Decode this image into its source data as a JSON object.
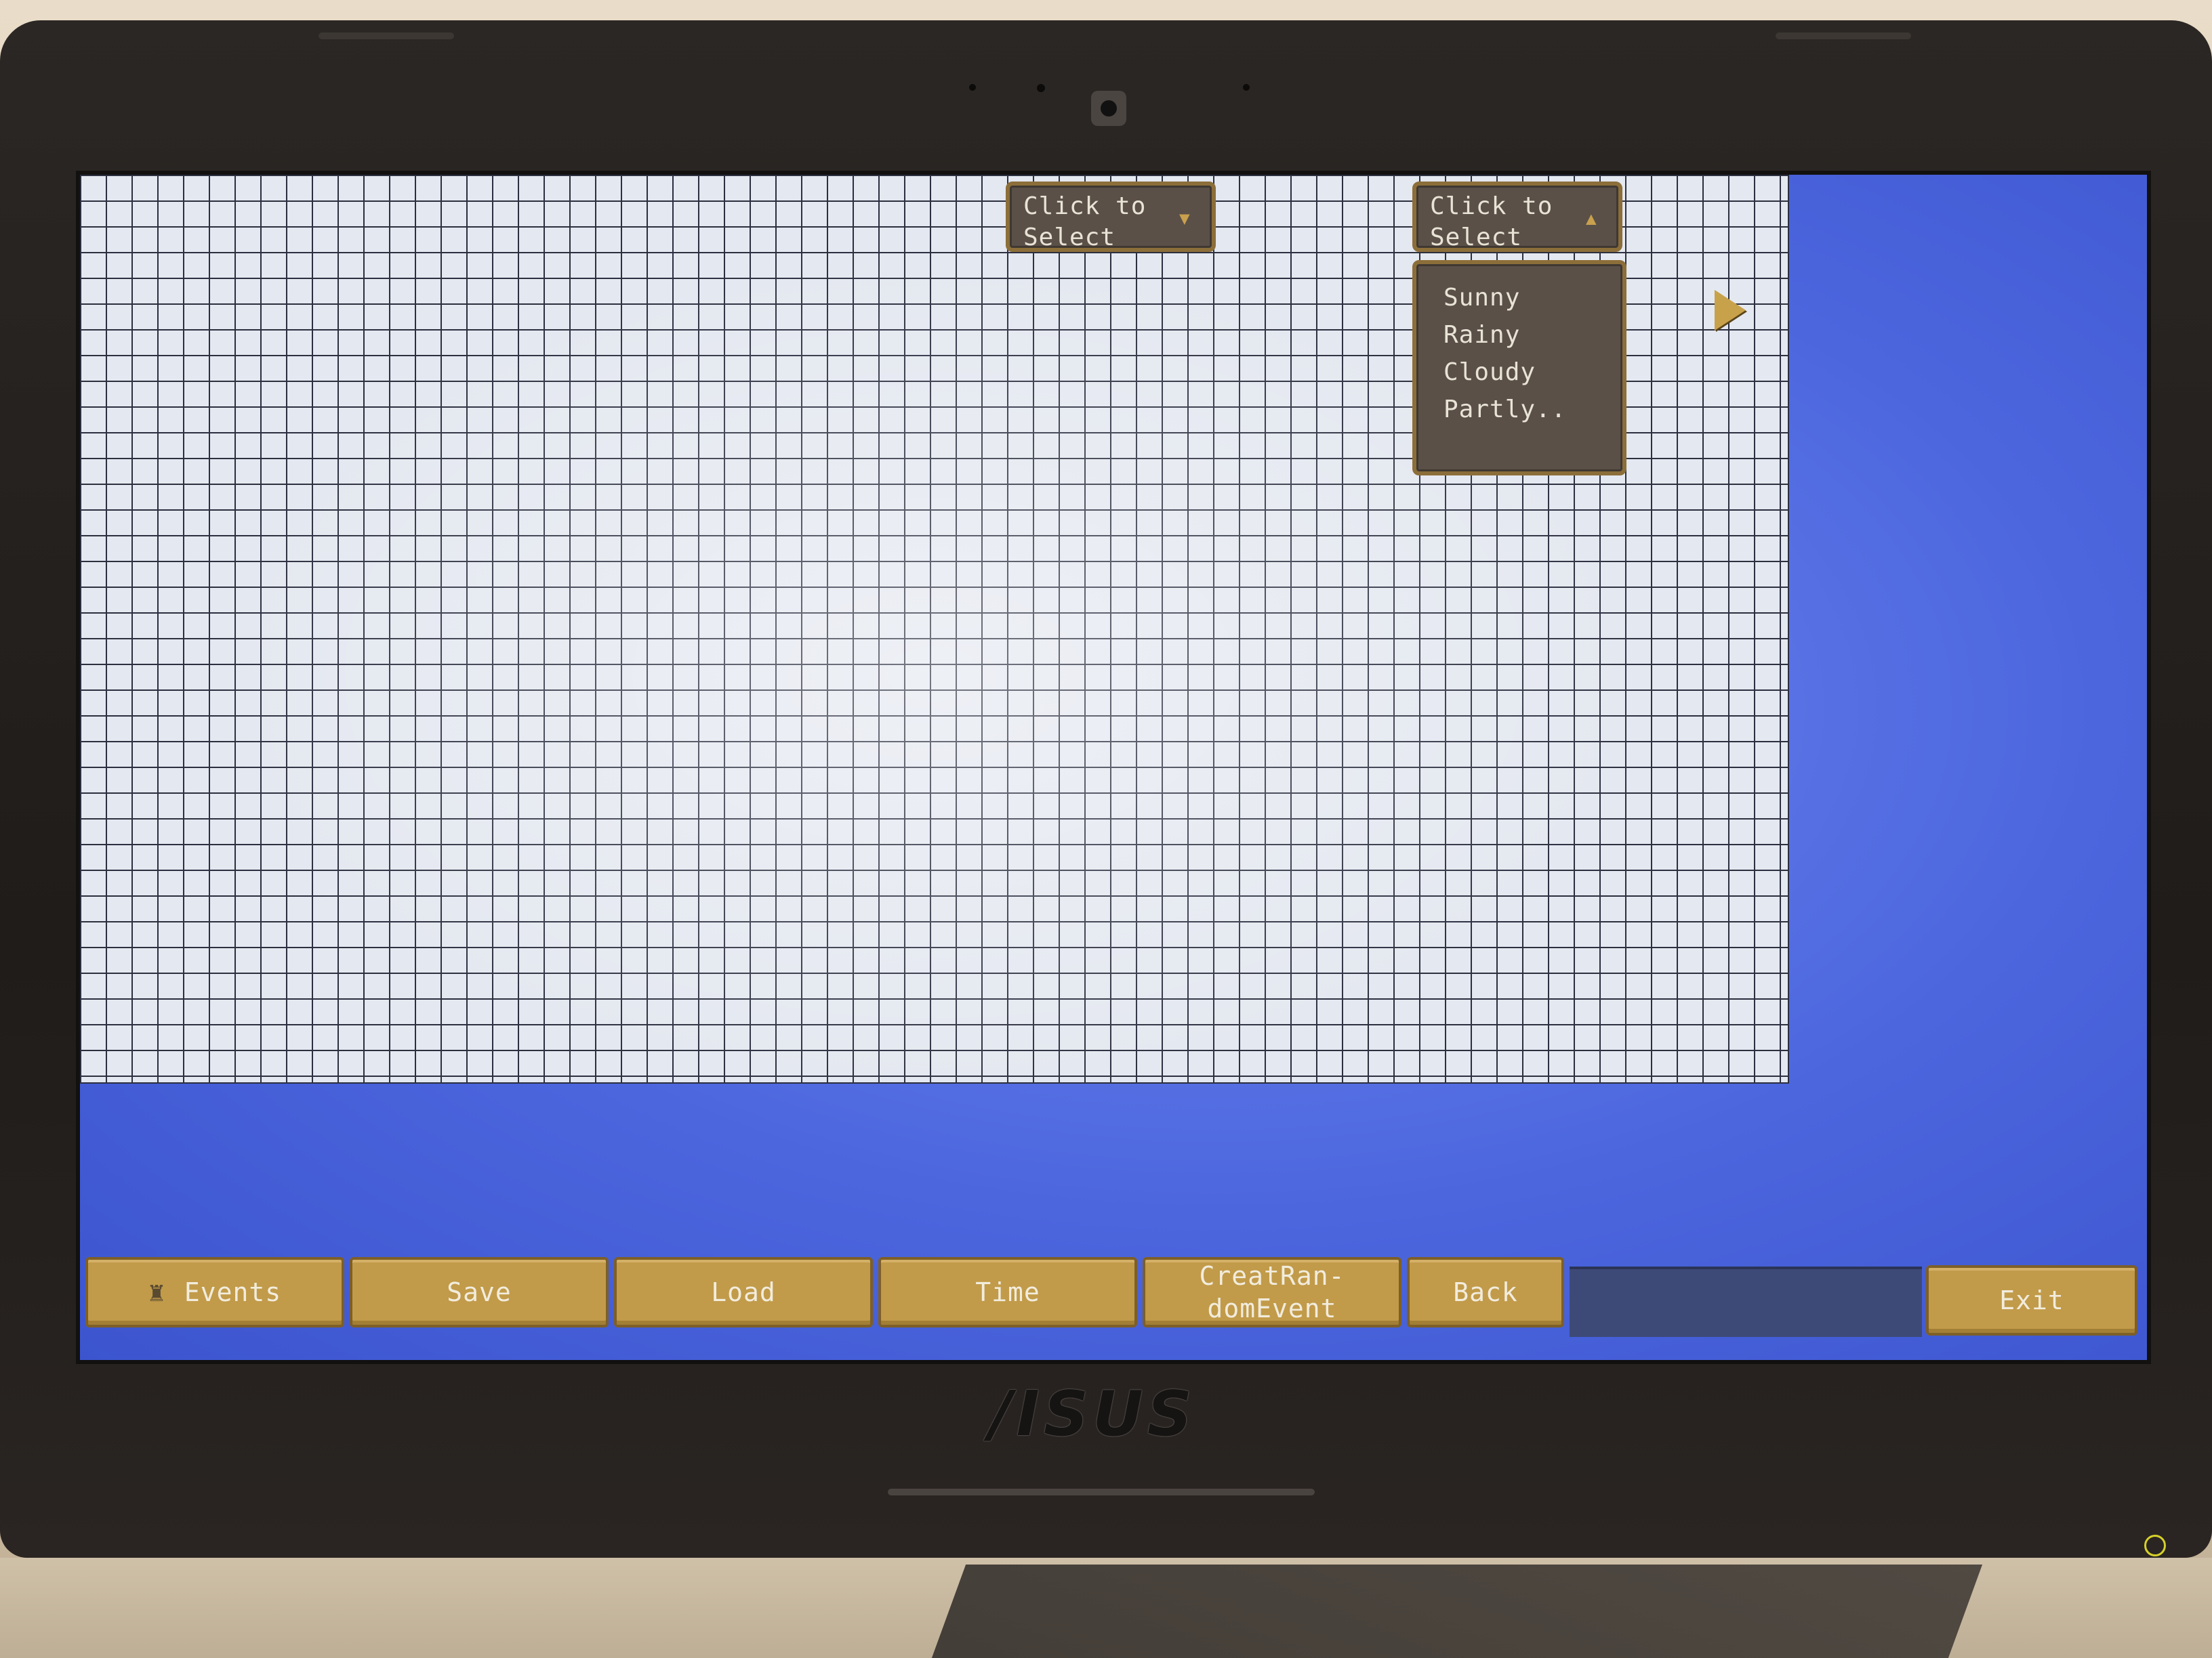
{
  "device": {
    "brand_logo": "/ISUS"
  },
  "dropdown_left": {
    "label": "Click to\nSelect",
    "arrow_icon": "triangle-down-icon"
  },
  "dropdown_right": {
    "label": "Click to\nSelect",
    "arrow_icon": "triangle-up-icon",
    "options": [
      "Sunny",
      "Rainy",
      "Cloudy",
      "Partly.."
    ]
  },
  "taskbar": {
    "events": "Events",
    "events_icon": "scroll-icon",
    "save": "Save",
    "load": "Load",
    "time": "Time",
    "create_random_event": "CreatRan-\ndomEvent",
    "back": "Back",
    "exit": "Exit"
  },
  "colors": {
    "desktop_blue": "#4c66de",
    "grid_bg": "#e4e8f0",
    "button_gold": "#c19b4a",
    "dropdown_brown": "#5a5048"
  }
}
